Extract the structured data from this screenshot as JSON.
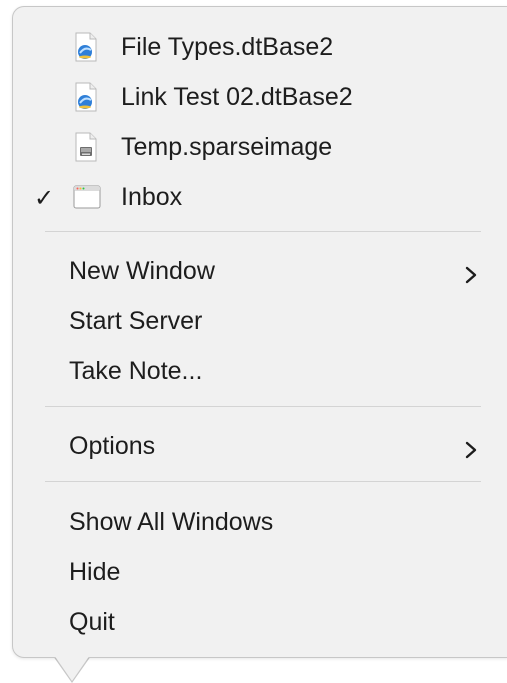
{
  "files": [
    {
      "label": "File Types.dtBase2",
      "icon": "dtbase-file-icon",
      "checked": false
    },
    {
      "label": "Link Test 02.dtBase2",
      "icon": "dtbase-file-icon",
      "checked": false
    },
    {
      "label": "Temp.sparseimage",
      "icon": "disk-image-file-icon",
      "checked": false
    },
    {
      "label": "Inbox",
      "icon": "inbox-window-icon",
      "checked": true,
      "check_mark": "✓"
    }
  ],
  "commands": {
    "new_window": "New Window",
    "start_server": "Start Server",
    "take_note": "Take Note...",
    "options": "Options",
    "show_all_windows": "Show All Windows",
    "hide": "Hide",
    "quit": "Quit"
  },
  "colors": {
    "menu_background": "#f1f1f1",
    "text": "#1d1d1d",
    "separator": "#d4d4d4",
    "dtbase_icon_accent": "#2f7fd8"
  }
}
